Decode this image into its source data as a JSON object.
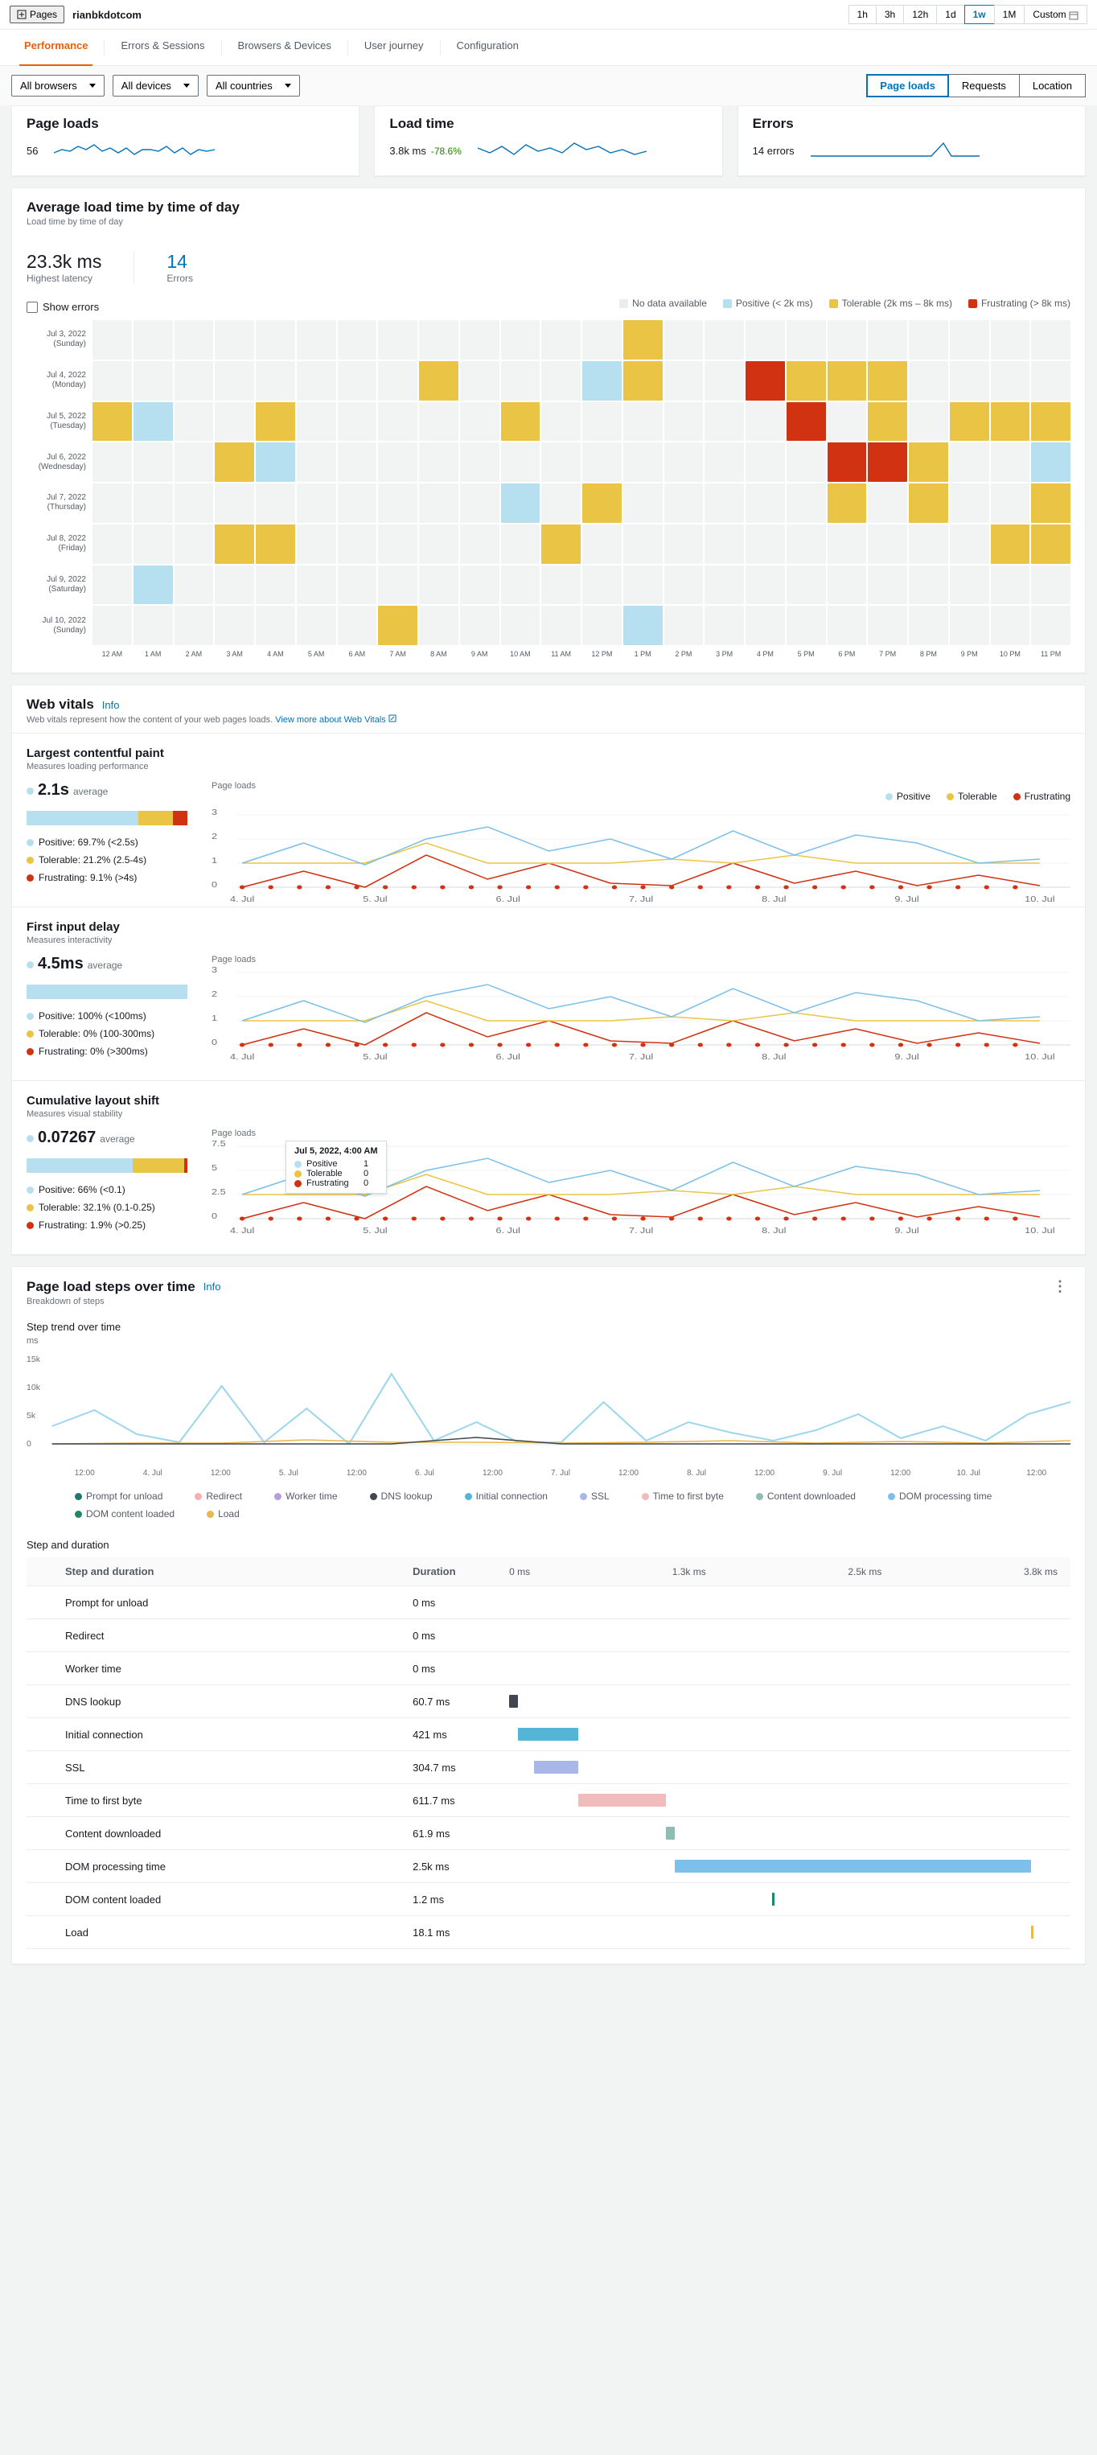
{
  "topbar": {
    "pages_label": "Pages",
    "breadcrumb": "rianbkdotcom"
  },
  "time_range": [
    "1h",
    "3h",
    "12h",
    "1d",
    "1w",
    "1M",
    "Custom"
  ],
  "time_active": "1w",
  "tabs": [
    "Performance",
    "Errors & Sessions",
    "Browsers & Devices",
    "User journey",
    "Configuration"
  ],
  "filters": {
    "browsers": "All browsers",
    "devices": "All devices",
    "countries": "All countries"
  },
  "segments": [
    "Page loads",
    "Requests",
    "Location"
  ],
  "seg_active": "Page loads",
  "cards": {
    "page_loads": {
      "title": "Page loads",
      "value": "56"
    },
    "load_time": {
      "title": "Load time",
      "value": "3.8k ms",
      "delta": "-78.6%"
    },
    "errors": {
      "title": "Errors",
      "value": "14 errors"
    }
  },
  "heatmap": {
    "title": "Average load time by time of day",
    "sub": "Load time by time of day",
    "kpi1": {
      "val": "23.3k ms",
      "lbl": "Highest latency"
    },
    "kpi2": {
      "val": "14",
      "lbl": "Errors"
    },
    "show_errors": "Show errors",
    "legend": {
      "none": "No data available",
      "pos": "Positive (< 2k ms)",
      "tol": "Tolerable (2k ms – 8k ms)",
      "fru": "Frustrating (> 8k ms)"
    },
    "days": [
      {
        "label": "Jul 3, 2022",
        "sub": "(Sunday)"
      },
      {
        "label": "Jul 4, 2022",
        "sub": "(Monday)"
      },
      {
        "label": "Jul 5, 2022",
        "sub": "(Tuesday)"
      },
      {
        "label": "Jul 6, 2022",
        "sub": "(Wednesday)"
      },
      {
        "label": "Jul 7, 2022",
        "sub": "(Thursday)"
      },
      {
        "label": "Jul 8, 2022",
        "sub": "(Friday)"
      },
      {
        "label": "Jul 9, 2022",
        "sub": "(Saturday)"
      },
      {
        "label": "Jul 10, 2022",
        "sub": "(Sunday)"
      }
    ],
    "hours": [
      "12 AM",
      "1 AM",
      "2 AM",
      "3 AM",
      "4 AM",
      "5 AM",
      "6 AM",
      "7 AM",
      "8 AM",
      "9 AM",
      "10 AM",
      "11 AM",
      "12 PM",
      "1 PM",
      "2 PM",
      "3 PM",
      "4 PM",
      "5 PM",
      "6 PM",
      "7 PM",
      "8 PM",
      "9 PM",
      "10 PM",
      "11 PM"
    ]
  },
  "chart_data": {
    "heatmap": {
      "type": "heatmap",
      "x": [
        "12 AM",
        "1 AM",
        "2 AM",
        "3 AM",
        "4 AM",
        "5 AM",
        "6 AM",
        "7 AM",
        "8 AM",
        "9 AM",
        "10 AM",
        "11 AM",
        "12 PM",
        "1 PM",
        "2 PM",
        "3 PM",
        "4 PM",
        "5 PM",
        "6 PM",
        "7 PM",
        "8 PM",
        "9 PM",
        "10 PM",
        "11 PM"
      ],
      "y": [
        "Jul 3",
        "Jul 4",
        "Jul 5",
        "Jul 6",
        "Jul 7",
        "Jul 8",
        "Jul 9",
        "Jul 10"
      ],
      "legend": {
        "0": "none",
        "1": "positive",
        "2": "tolerable",
        "3": "frustrating"
      },
      "values": [
        [
          0,
          0,
          0,
          0,
          0,
          0,
          0,
          0,
          0,
          0,
          0,
          0,
          0,
          2,
          0,
          0,
          0,
          0,
          0,
          0,
          0,
          0,
          0,
          0
        ],
        [
          0,
          0,
          0,
          0,
          0,
          0,
          0,
          0,
          2,
          0,
          0,
          0,
          1,
          2,
          0,
          0,
          3,
          2,
          2,
          2,
          0,
          0,
          0,
          0
        ],
        [
          2,
          1,
          0,
          0,
          2,
          0,
          0,
          0,
          0,
          0,
          2,
          0,
          0,
          0,
          0,
          0,
          0,
          3,
          0,
          2,
          0,
          2,
          2,
          2
        ],
        [
          0,
          0,
          0,
          2,
          1,
          0,
          0,
          0,
          0,
          0,
          0,
          0,
          0,
          0,
          0,
          0,
          0,
          0,
          3,
          3,
          2,
          0,
          0,
          1
        ],
        [
          0,
          0,
          0,
          0,
          0,
          0,
          0,
          0,
          0,
          0,
          1,
          0,
          2,
          0,
          0,
          0,
          0,
          0,
          2,
          0,
          2,
          0,
          0,
          2
        ],
        [
          0,
          0,
          0,
          2,
          2,
          0,
          0,
          0,
          0,
          0,
          0,
          2,
          0,
          0,
          0,
          0,
          0,
          0,
          0,
          0,
          0,
          0,
          2,
          2
        ],
        [
          0,
          1,
          0,
          0,
          0,
          0,
          0,
          0,
          0,
          0,
          0,
          0,
          0,
          0,
          0,
          0,
          0,
          0,
          0,
          0,
          0,
          0,
          0,
          0
        ],
        [
          0,
          0,
          0,
          0,
          0,
          0,
          0,
          2,
          0,
          0,
          0,
          0,
          0,
          1,
          0,
          0,
          0,
          0,
          0,
          0,
          0,
          0,
          0,
          0
        ]
      ]
    },
    "lcp": {
      "type": "line",
      "title": "Page loads",
      "x": [
        "4. Jul",
        "5. Jul",
        "6. Jul",
        "7. Jul",
        "8. Jul",
        "9. Jul",
        "10. Jul"
      ],
      "ylim": [
        0,
        3
      ]
    },
    "fid": {
      "type": "line",
      "title": "Page loads",
      "x": [
        "4. Jul",
        "5. Jul",
        "6. Jul",
        "7. Jul",
        "8. Jul",
        "9. Jul",
        "10. Jul"
      ],
      "ylim": [
        0,
        3
      ]
    },
    "cls": {
      "type": "line",
      "title": "Page loads",
      "x": [
        "4. Jul",
        "5. Jul",
        "6. Jul",
        "7. Jul",
        "8. Jul",
        "9. Jul",
        "10. Jul"
      ],
      "ylim": [
        0,
        7.5
      ]
    },
    "trend": {
      "type": "line",
      "title": "ms",
      "x": [
        "12:00",
        "4. Jul",
        "12:00",
        "5. Jul",
        "12:00",
        "6. Jul",
        "12:00",
        "7. Jul",
        "12:00",
        "8. Jul",
        "12:00",
        "9. Jul",
        "12:00",
        "10. Jul",
        "12:00"
      ],
      "ylim": [
        0,
        15000
      ]
    },
    "gantt": {
      "type": "table",
      "columns": [
        "Step and duration",
        "Duration"
      ],
      "scale": [
        "0 ms",
        "1.3k ms",
        "2.5k ms",
        "3.8k ms"
      ],
      "rows": [
        {
          "step": "Prompt for unload",
          "dur": "0 ms",
          "start": 0,
          "width": 0,
          "color": "#1f7869"
        },
        {
          "step": "Redirect",
          "dur": "0 ms",
          "start": 0,
          "width": 0,
          "color": "#f7b0b0"
        },
        {
          "step": "Worker time",
          "dur": "0 ms",
          "start": 0,
          "width": 0,
          "color": "#b99ce0"
        },
        {
          "step": "DNS lookup",
          "dur": "60.7 ms",
          "start": 0,
          "width": 1.6,
          "color": "#414750"
        },
        {
          "step": "Initial connection",
          "dur": "421 ms",
          "start": 1.6,
          "width": 11,
          "color": "#55b5d6"
        },
        {
          "step": "SSL",
          "dur": "304.7 ms",
          "start": 4.6,
          "width": 8,
          "color": "#a9b6e8"
        },
        {
          "step": "Time to first byte",
          "dur": "611.7 ms",
          "start": 12.6,
          "width": 16,
          "color": "#f0bcbc"
        },
        {
          "step": "Content downloaded",
          "dur": "61.9 ms",
          "start": 28.6,
          "width": 1.6,
          "color": "#8fbdb3"
        },
        {
          "step": "DOM processing time",
          "dur": "2.5k ms",
          "start": 30.2,
          "width": 65,
          "color": "#7cc0eb"
        },
        {
          "step": "DOM content loaded",
          "dur": "1.2 ms",
          "start": 48,
          "width": 0.5,
          "color": "#1d8869",
          "line": true
        },
        {
          "step": "Load",
          "dur": "18.1 ms",
          "start": 95.2,
          "width": 0.5,
          "color": "#e8b74e",
          "line": true
        }
      ]
    }
  },
  "webvitals": {
    "title": "Web vitals",
    "info": "Info",
    "desc": "Web vitals represent how the content of your web pages loads.",
    "link": "View more about Web Vitals",
    "legend": {
      "pos": "Positive",
      "tol": "Tolerable",
      "fru": "Frustrating"
    },
    "lcp": {
      "title": "Largest contentful paint",
      "sub": "Measures loading performance",
      "avg": "2.1s",
      "avg_lbl": "average",
      "bars": [
        69.7,
        21.2,
        9.1
      ],
      "breakdown": [
        "Positive: 69.7% (<2.5s)",
        "Tolerable: 21.2% (2.5-4s)",
        "Frustrating: 9.1% (>4s)"
      ]
    },
    "fid": {
      "title": "First input delay",
      "sub": "Measures interactivity",
      "avg": "4.5ms",
      "avg_lbl": "average",
      "bars": [
        100,
        0,
        0
      ],
      "breakdown": [
        "Positive: 100% (<100ms)",
        "Tolerable: 0% (100-300ms)",
        "Frustrating: 0% (>300ms)"
      ]
    },
    "cls": {
      "title": "Cumulative layout shift",
      "sub": "Measures visual stability",
      "avg": "0.07267",
      "avg_lbl": "average",
      "bars": [
        66,
        32.1,
        1.9
      ],
      "breakdown": [
        "Positive: 66% (<0.1)",
        "Tolerable: 32.1% (0.1-0.25)",
        "Frustrating: 1.9% (>0.25)"
      ],
      "tooltip": {
        "date": "Jul 5, 2022, 4:00 AM",
        "rows": [
          [
            "Positive",
            "1"
          ],
          [
            "Tolerable",
            "0"
          ],
          [
            "Frustrating",
            "0"
          ]
        ]
      }
    }
  },
  "steps": {
    "title": "Page load steps over time",
    "info": "Info",
    "sub": "Breakdown of steps",
    "trend_title": "Step trend over time",
    "trend_unit": "ms",
    "legend": [
      "Prompt for unload",
      "Redirect",
      "Worker time",
      "DNS lookup",
      "Initial connection",
      "SSL",
      "Time to first byte",
      "Content downloaded",
      "DOM processing time",
      "DOM content loaded",
      "Load"
    ],
    "legend_colors": [
      "#1f7869",
      "#f7b0b0",
      "#b99ce0",
      "#414750",
      "#55b5d6",
      "#a9b6e8",
      "#f0bcbc",
      "#8fbdb3",
      "#7cc0eb",
      "#1d8869",
      "#e8b74e"
    ],
    "table_section": "Step and duration",
    "table_head": [
      "Step and duration",
      "Duration",
      "0 ms",
      "1.3k ms",
      "2.5k ms",
      "3.8k ms"
    ]
  }
}
